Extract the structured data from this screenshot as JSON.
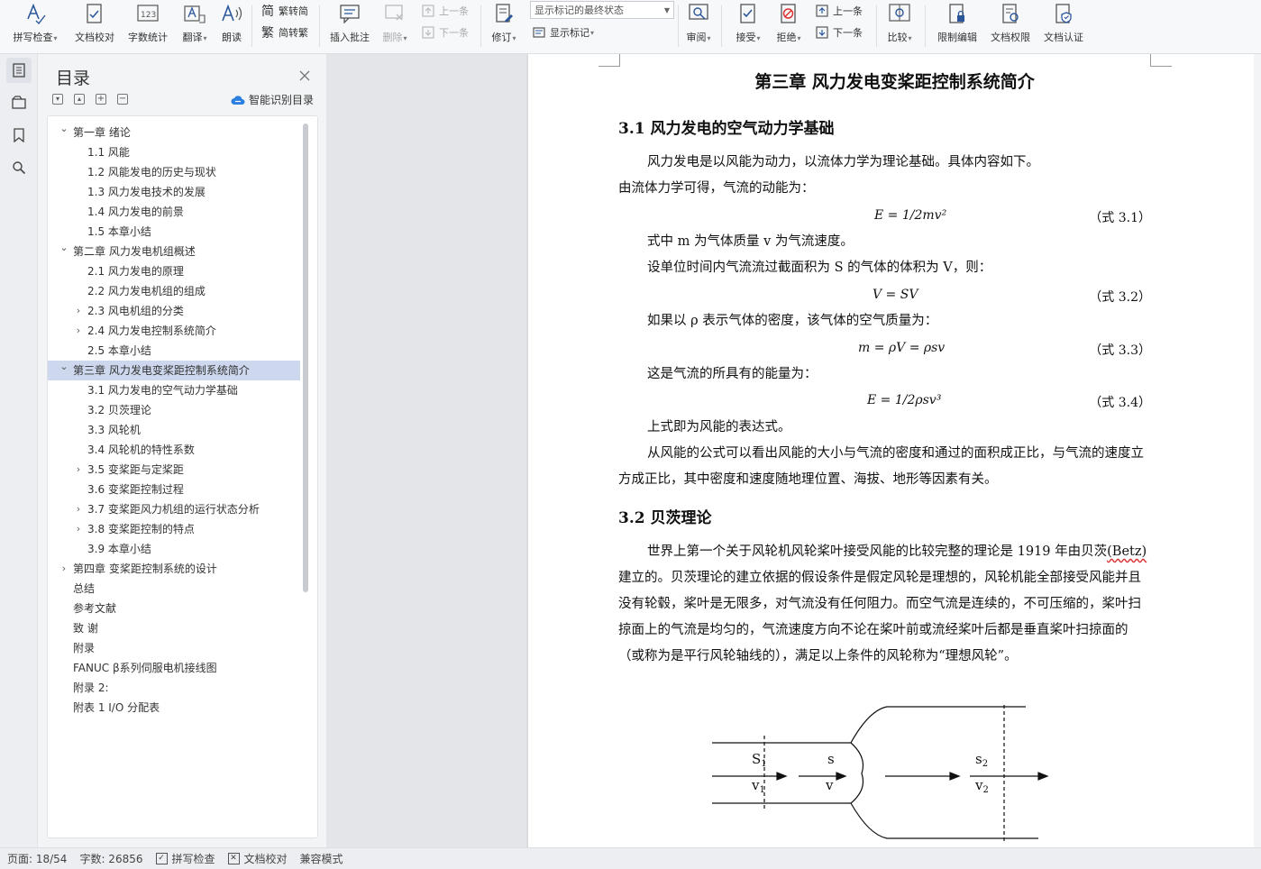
{
  "ribbon": {
    "spell_check": "拼写检查",
    "doc_proofread": "文档校对",
    "word_count": "字数统计",
    "translate": "翻译",
    "read_aloud": "朗读",
    "trad_to_simp": "繁转简",
    "simp_to_trad": "简转繁",
    "insert_comment": "插入批注",
    "delete": "删除",
    "prev_comment": "上一条",
    "next_comment": "下一条",
    "revise": "修订",
    "markup_select_value": "显示标记的最终状态",
    "show_markup": "显示标记",
    "review": "审阅",
    "accept": "接受",
    "reject": "拒绝",
    "prev_change": "上一条",
    "next_change": "下一条",
    "compare": "比较",
    "restrict_edit": "限制编辑",
    "doc_permission": "文档权限",
    "doc_certify": "文档认证"
  },
  "toc": {
    "title": "目录",
    "smart_toc": "智能识别目录",
    "items": [
      {
        "text": "第一章  绪论",
        "level": 0,
        "arrow": "down"
      },
      {
        "text": "1.1 风能",
        "level": 1,
        "arrow": ""
      },
      {
        "text": "1.2 风能发电的历史与现状",
        "level": 1,
        "arrow": ""
      },
      {
        "text": "1.3 风力发电技术的发展",
        "level": 1,
        "arrow": ""
      },
      {
        "text": "1.4 风力发电的前景",
        "level": 1,
        "arrow": ""
      },
      {
        "text": "1.5  本章小结",
        "level": 1,
        "arrow": ""
      },
      {
        "text": "第二章  风力发电机组概述",
        "level": 0,
        "arrow": "down"
      },
      {
        "text": "2.1  风力发电的原理",
        "level": 1,
        "arrow": ""
      },
      {
        "text": "2.2  风力发电机组的组成",
        "level": 1,
        "arrow": ""
      },
      {
        "text": "2.3  风电机组的分类",
        "level": 1,
        "arrow": "right"
      },
      {
        "text": "2.4  风力发电控制系统简介",
        "level": 1,
        "arrow": "right"
      },
      {
        "text": "2.5  本章小结",
        "level": 1,
        "arrow": ""
      },
      {
        "text": "第三章  风力发电变桨距控制系统简介",
        "level": 0,
        "arrow": "down",
        "active": true
      },
      {
        "text": "3.1  风力发电的空气动力学基础",
        "level": 1,
        "arrow": ""
      },
      {
        "text": "3.2 贝茨理论",
        "level": 1,
        "arrow": ""
      },
      {
        "text": "3.3  风轮机",
        "level": 1,
        "arrow": ""
      },
      {
        "text": "3.4  风轮机的特性系数",
        "level": 1,
        "arrow": ""
      },
      {
        "text": "3.5 变桨距与定桨距",
        "level": 1,
        "arrow": "right"
      },
      {
        "text": "3.6  变桨距控制过程",
        "level": 1,
        "arrow": ""
      },
      {
        "text": "3.7  变桨距风力机组的运行状态分析",
        "level": 1,
        "arrow": "right"
      },
      {
        "text": "3.8  变桨距控制的特点",
        "level": 1,
        "arrow": "right"
      },
      {
        "text": "3.9  本章小结",
        "level": 1,
        "arrow": ""
      },
      {
        "text": "第四章  变桨距控制系统的设计",
        "level": 0,
        "arrow": "right"
      },
      {
        "text": "总结",
        "level": 0,
        "arrow": ""
      },
      {
        "text": "参考文献",
        "level": 0,
        "arrow": ""
      },
      {
        "text": "致    谢",
        "level": 0,
        "arrow": ""
      },
      {
        "text": "附录",
        "level": 0,
        "arrow": ""
      },
      {
        "text": "FANUC β系列伺服电机接线图",
        "level": 0,
        "arrow": ""
      },
      {
        "text": "附录 2:",
        "level": 0,
        "arrow": ""
      },
      {
        "text": "附表 1    I/O 分配表",
        "level": 0,
        "arrow": ""
      }
    ]
  },
  "doc": {
    "chapter_title": "第三章  风力发电变桨距控制系统简介",
    "h_31": "3.1  风力发电的空气动力学基础",
    "p1": "风力发电是以风能为动力，以流体力学为理论基础。具体内容如下。",
    "p2": "由流体力学可得，气流的动能为：",
    "eq1": "E = 1/2mv²",
    "eq1_num": "（式 3.1）",
    "p3": "式中  m 为气体质量  v  为气流速度。",
    "p4": "设单位时间内气流流过截面积为 S 的气体的体积为 V，则：",
    "eq2": "V = SV",
    "eq2_num": "（式 3.2）",
    "p5": "如果以 ρ 表示气体的密度，该气体的空气质量为：",
    "eq3": "m = ρV = ρsv",
    "eq3_num": "（式 3.3）",
    "p6": "这是气流的所具有的能量为：",
    "eq4": "E = 1/2ρsv³",
    "eq4_num": "（式 3.4）",
    "p7": "上式即为风能的表达式。",
    "p8": "从风能的公式可以看出风能的大小与气流的密度和通过的面积成正比，与气流的速度立方成正比，其中密度和速度随地理位置、海拔、地形等因素有关。",
    "h_32": "3.2 贝茨理论",
    "p9_a": "世界上第一个关于风轮机风轮桨叶接受风能的比较完整的理论是 1919 年由贝茨",
    "p9_betz": "(Betz)",
    "p9_b": "建立的。贝茨理论的建立依据的假设条件是假定风轮是理想的，风轮机能全部接受风能并且没有轮毂，桨叶是无限多，对气流没有任何阻力。而空气流是连续的，不可压缩的，桨叶扫掠面上的气流是均匀的，气流速度方向不论在桨叶前或流经桨叶后都是垂直桨叶扫掠面的（或称为是平行风轮轴线的），满足以上条件的风轮称为“理想风轮”。",
    "fig_s1": "S",
    "fig_s1_sub": "1",
    "fig_v1": "v",
    "fig_v1_sub": "1",
    "fig_s": "s",
    "fig_v": "v",
    "fig_s2": "s",
    "fig_s2_sub": "2",
    "fig_v2": "v",
    "fig_v2_sub": "2"
  },
  "status": {
    "page": "页面: 18/54",
    "words": "字数: 26856",
    "spell": "拼写检查",
    "proof": "文档校对",
    "compat": "兼容模式"
  }
}
